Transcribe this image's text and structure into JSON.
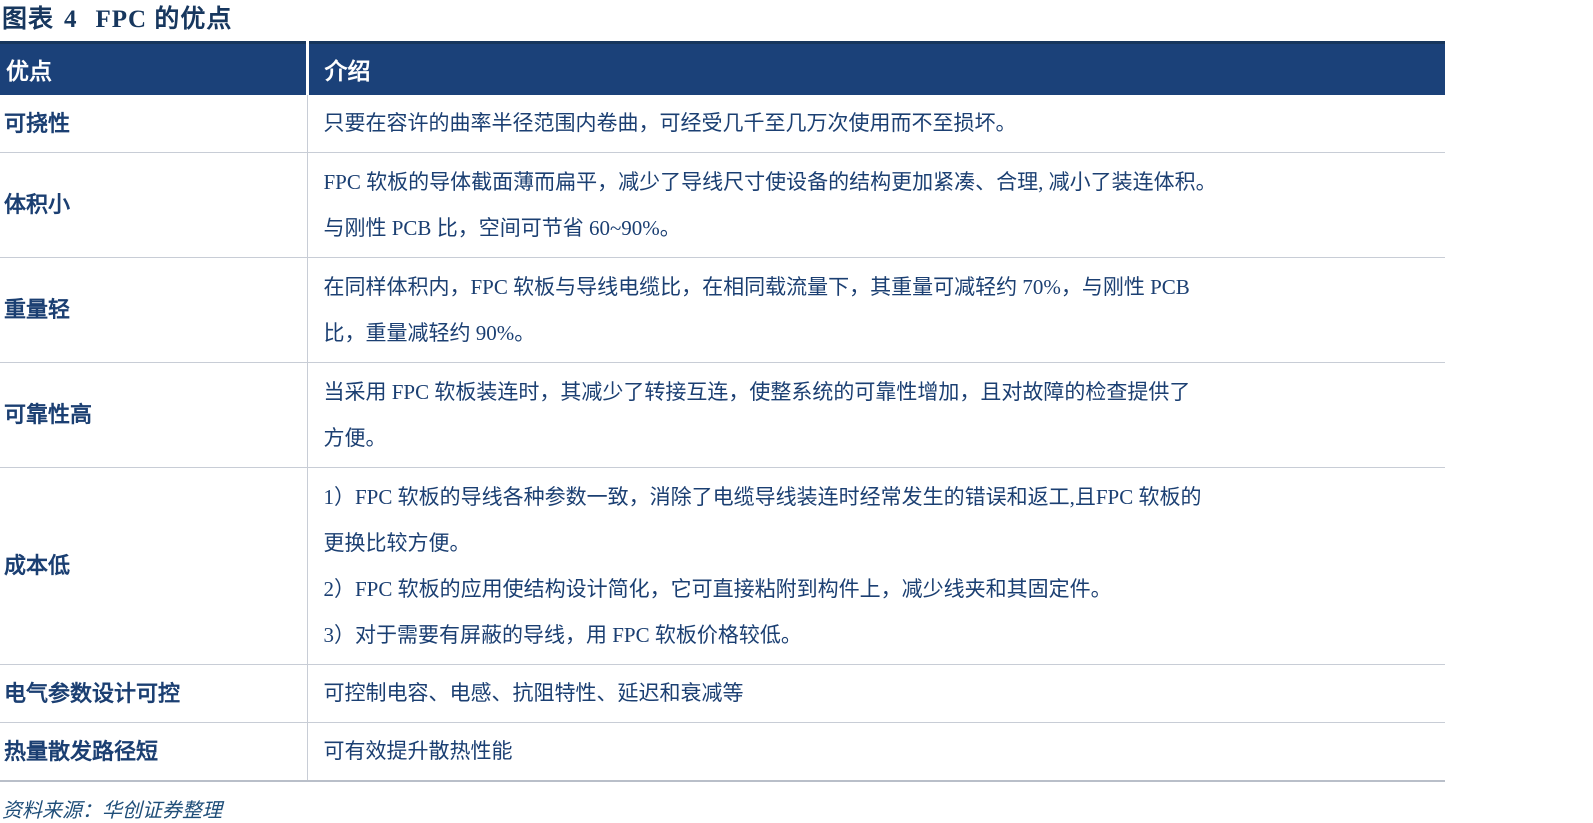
{
  "caption": {
    "prefix": "图表",
    "number": "4",
    "title": "FPC 的优点"
  },
  "table": {
    "headers": {
      "advantage": "优点",
      "description": "介绍"
    },
    "rows": [
      {
        "label": "可挠性",
        "lines": [
          "只要在容许的曲率半径范围内卷曲，可经受几千至几万次使用而不至损坏。"
        ]
      },
      {
        "label": "体积小",
        "lines": [
          "FPC 软板的导体截面薄而扁平，减少了导线尺寸使设备的结构更加紧凑、合理, 减小了装连体积。",
          "与刚性 PCB 比，空间可节省 60~90%。"
        ]
      },
      {
        "label": "重量轻",
        "lines": [
          "在同样体积内，FPC 软板与导线电缆比，在相同载流量下，其重量可减轻约 70%，与刚性 PCB",
          "比，重量减轻约 90%。"
        ]
      },
      {
        "label": "可靠性高",
        "lines": [
          "当采用 FPC 软板装连时，其减少了转接互连，使整系统的可靠性增加，且对故障的检查提供了",
          "方便。"
        ]
      },
      {
        "label": "成本低",
        "lines": [
          "1）FPC 软板的导线各种参数一致，消除了电缆导线装连时经常发生的错误和返工,且FPC 软板的",
          "更换比较方便。",
          "2）FPC 软板的应用使结构设计简化，它可直接粘附到构件上，减少线夹和其固定件。",
          "3）对于需要有屏蔽的导线，用 FPC 软板价格较低。"
        ]
      },
      {
        "label": "电气参数设计可控",
        "lines": [
          "可控制电容、电感、抗阻特性、延迟和衰减等"
        ]
      },
      {
        "label": "热量散发路径短",
        "lines": [
          "可有效提升散热性能"
        ]
      }
    ]
  },
  "source": "资料来源：华创证券整理",
  "colors": {
    "header_bg": "#1b4179",
    "text": "#1b3f72",
    "caption": "#17375e",
    "border": "#c8cdd6",
    "top_rule": "#17365d"
  }
}
